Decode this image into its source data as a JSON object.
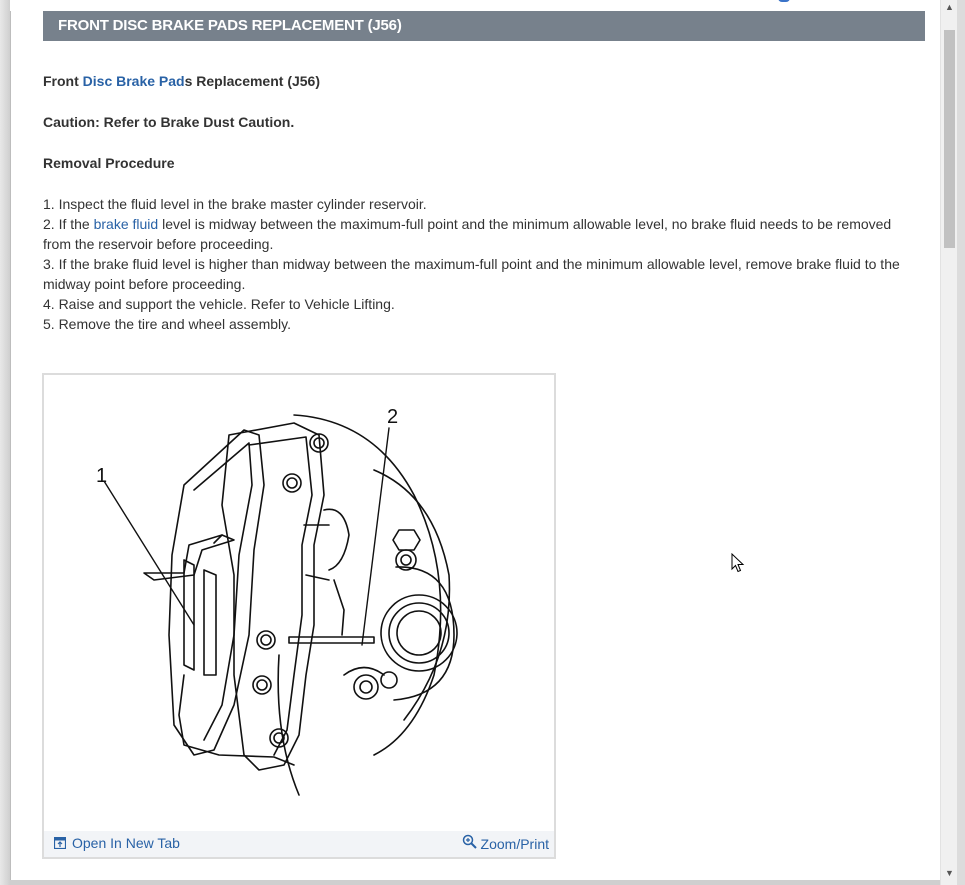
{
  "header": {
    "title": "FRONT DISC BRAKE PADS REPLACEMENT (J56)"
  },
  "heading": {
    "prefix": "Front ",
    "link": "Disc Brake Pad",
    "suffix": "s Replacement (J56)"
  },
  "caution": "Caution: Refer to Brake Dust Caution.",
  "section_title": "Removal Procedure",
  "steps": {
    "s1": " 1. Inspect the fluid level in the brake master cylinder reservoir.",
    "s2_prefix": " 2. If the ",
    "s2_link": "brake fluid",
    "s2_suffix": " level is midway between the maximum-full point and the minimum allowable level, no brake fluid needs to be removed from the reservoir before proceeding.",
    "s3": " 3. If the brake fluid level is higher than midway between the maximum-full point and the minimum allowable level, remove brake fluid to the midway point before proceeding.",
    "s4": " 4. Raise and support the vehicle. Refer to Vehicle Lifting.",
    "s5": " 5. Remove the tire and wheel assembly."
  },
  "figure": {
    "callout_1": "1",
    "callout_2": "2",
    "open_tab_label": "Open In New Tab",
    "zoom_label": "Zoom/Print",
    "open_tab_icon": "open-tab-icon",
    "zoom_icon": "magnifier-icon"
  },
  "colors": {
    "header_bg": "#77818c",
    "link": "#2962a6"
  }
}
